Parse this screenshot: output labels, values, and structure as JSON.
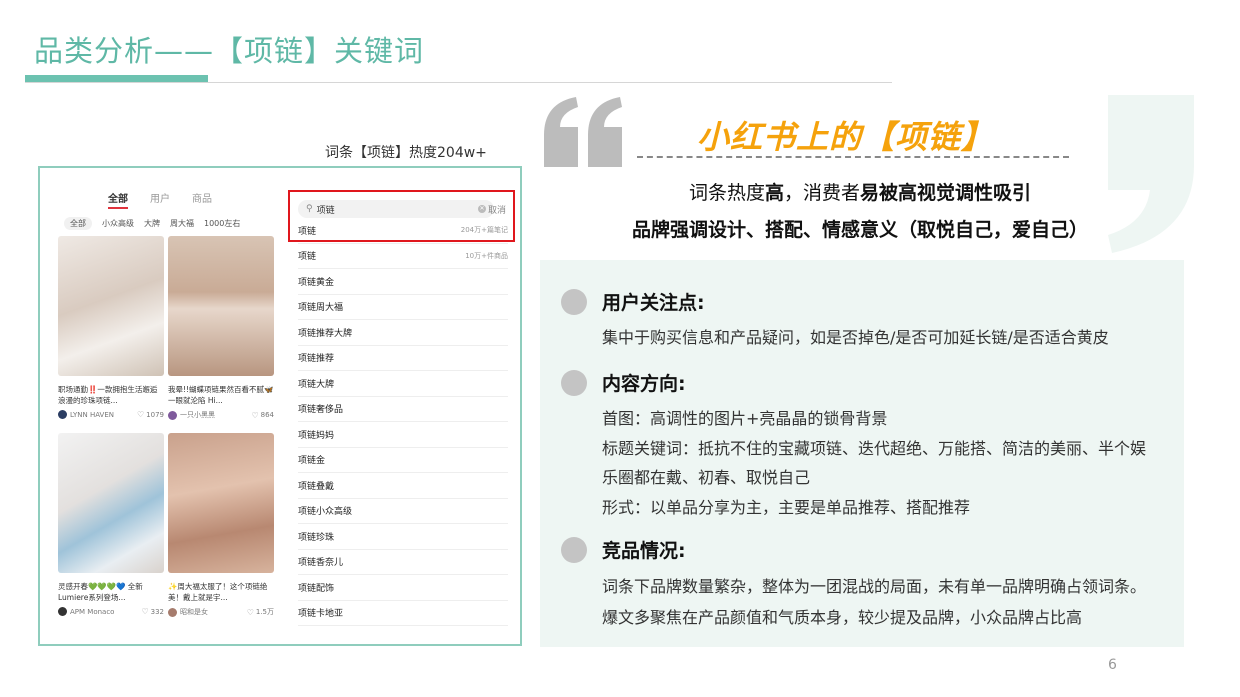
{
  "slide": {
    "title": "品类分析——【项链】关键词",
    "page_number": "6"
  },
  "screenshot": {
    "caption": "词条【项链】热度204w+",
    "tabs": [
      "全部",
      "用户",
      "商品"
    ],
    "filters": [
      "全部",
      "小众高级",
      "大牌",
      "周大福",
      "1000左右"
    ],
    "cards": [
      {
        "title": "职场通勤‼️一款拥抱生活邂逅浪漫的珍珠项链...",
        "author": "LYNN HAVEN",
        "likes": "1079"
      },
      {
        "title": "我晕!!蝴蝶项链果然百看不腻🦋一眼就沦陷 Hi...",
        "author": "一只小黑黑",
        "likes": "864"
      },
      {
        "title": "灵感开春💚💚💚💙 全新Lumiere系列登场...",
        "author": "APM Monaco",
        "likes": "332"
      },
      {
        "title": "✨周大福太服了！这个项链绝美！戴上就是宇...",
        "author": "昭和是女",
        "likes": "1.5万"
      }
    ],
    "search": {
      "query": "项链",
      "cancel": "取消",
      "suggestions": [
        {
          "text": "项链",
          "count": "204万+篇笔记"
        },
        {
          "text": "项链",
          "count": "10万+件商品"
        },
        {
          "text": "项链黄金",
          "count": ""
        },
        {
          "text": "项链周大福",
          "count": ""
        },
        {
          "text": "项链推荐大牌",
          "count": ""
        },
        {
          "text": "项链推荐",
          "count": ""
        },
        {
          "text": "项链大牌",
          "count": ""
        },
        {
          "text": "项链奢侈品",
          "count": ""
        },
        {
          "text": "项链妈妈",
          "count": ""
        },
        {
          "text": "项链金",
          "count": ""
        },
        {
          "text": "项链叠戴",
          "count": ""
        },
        {
          "text": "项链小众高级",
          "count": ""
        },
        {
          "text": "项链珍珠",
          "count": ""
        },
        {
          "text": "项链香奈儿",
          "count": ""
        },
        {
          "text": "项链配饰",
          "count": ""
        },
        {
          "text": "项链卡地亚",
          "count": ""
        }
      ]
    }
  },
  "headline": {
    "title": "小红书上的【项链】",
    "line1_a": "词条热度",
    "line1_b": "高",
    "line1_c": "，消费者",
    "line1_d": "易被高视觉调性吸引",
    "line2": "品牌强调设计、搭配、情感意义（取悦自己，爱自己）"
  },
  "sections": [
    {
      "heading": "用户关注点:",
      "lines": [
        "集中于购买信息和产品疑问，如是否掉色/是否可加延长链/是否适合黄皮"
      ]
    },
    {
      "heading": "内容方向:",
      "lines": [
        "首图：高调性的图片+亮晶晶的锁骨背景",
        "标题关键词：抵抗不住的宝藏项链、迭代超绝、万能搭、简洁的美丽、半个娱",
        "乐圈都在戴、初春、取悦自己",
        "形式：以单品分享为主，主要是单品推荐、搭配推荐"
      ]
    },
    {
      "heading": "竞品情况:",
      "lines": [
        "词条下品牌数量繁杂，整体为一团混战的局面，未有单一品牌明确占领词条。",
        "爆文多聚焦在产品颜值和气质本身，较少提及品牌，小众品牌占比高"
      ]
    }
  ],
  "colors": {
    "accent": "#5fb8a6",
    "headline": "#f5a20c",
    "highlight": "#e0171d",
    "panel": "#eef6f3"
  }
}
